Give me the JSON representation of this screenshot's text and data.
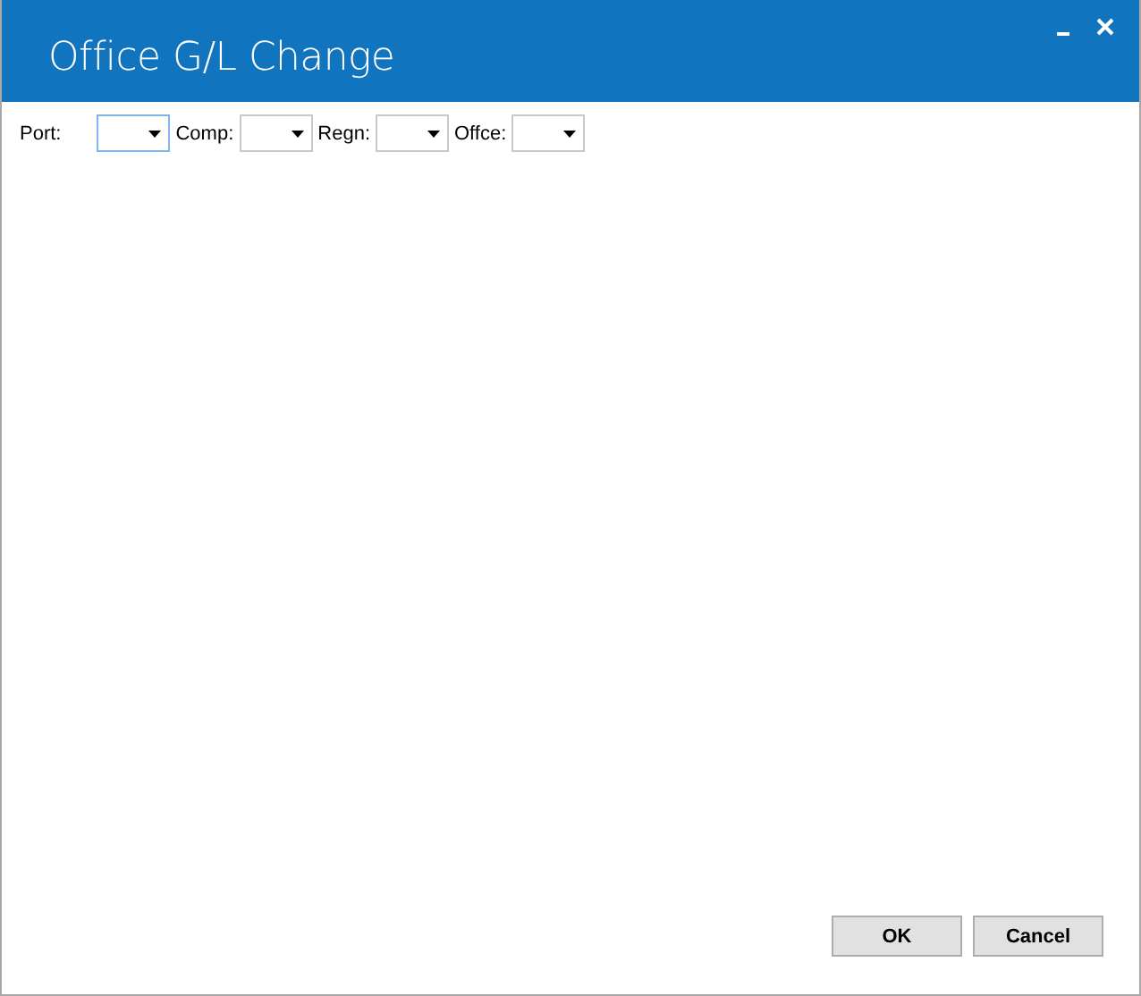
{
  "window": {
    "title": "Office G/L Change",
    "controls": [
      {
        "kind": "minimize"
      },
      {
        "kind": "close"
      }
    ]
  },
  "filters": [
    {
      "label": "Port:",
      "focused": true
    },
    {
      "label": "Comp:",
      "focused": false
    },
    {
      "label": "Regn:",
      "focused": false
    },
    {
      "label": "Offce:",
      "focused": false
    }
  ],
  "buttons": [
    "OK",
    "Cancel"
  ]
}
